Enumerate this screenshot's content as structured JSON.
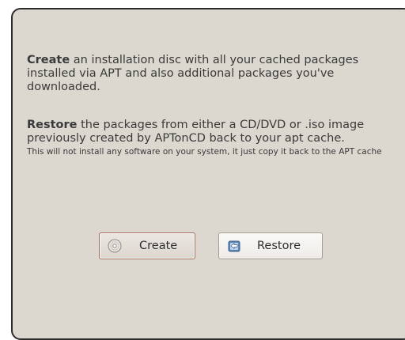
{
  "create": {
    "heading": "Create",
    "text": "an installation disc with all your cached packages installed via APT and also additional packages you've downloaded."
  },
  "restore": {
    "heading": "Restore",
    "text": "the packages from either a CD/DVD or .iso image previously created by APTonCD back to your apt cache.",
    "note": "This will not install any software on your system, it just copy it back to the APT cache"
  },
  "buttons": {
    "create_label": "Create",
    "create_icon": "cd-disc-icon",
    "restore_label": "Restore",
    "restore_icon": "restore-icon"
  },
  "colors": {
    "background": "#dcd8d0",
    "create_button_border": "#a46a5a"
  }
}
